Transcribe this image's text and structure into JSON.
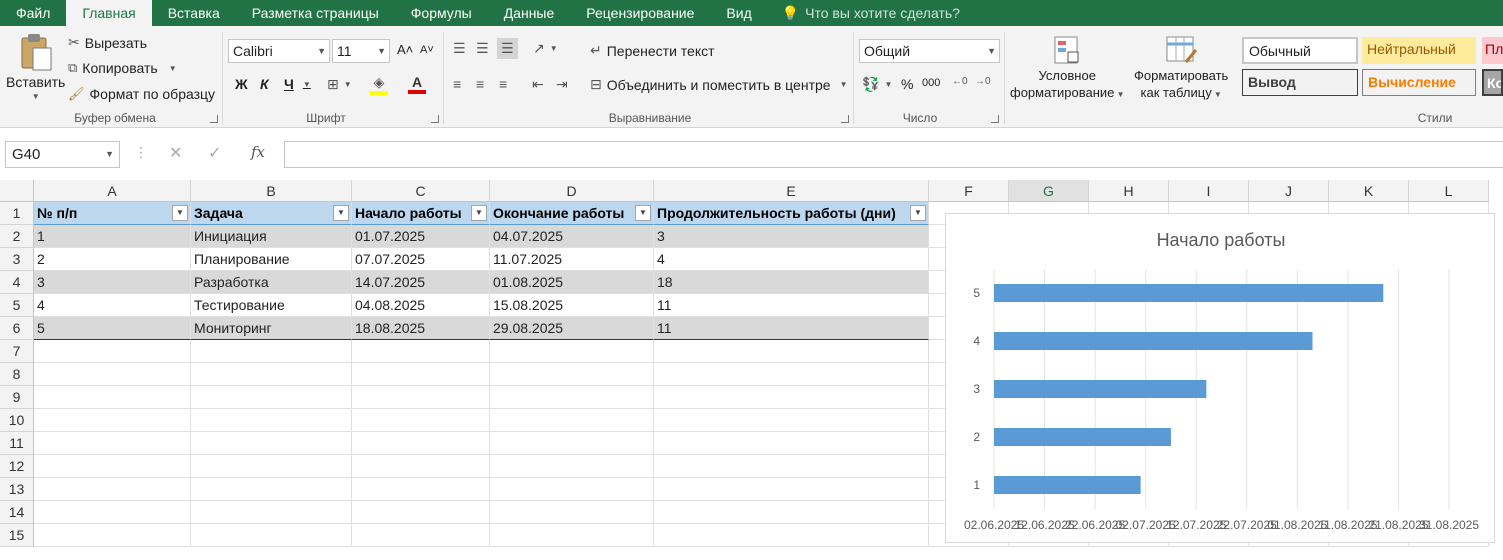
{
  "tabs": [
    "Файл",
    "Главная",
    "Вставка",
    "Разметка страницы",
    "Формулы",
    "Данные",
    "Рецензирование",
    "Вид"
  ],
  "active_tab": "Главная",
  "tell_me": "Что вы хотите сделать?",
  "ribbon": {
    "clipboard": {
      "paste": "Вставить",
      "cut": "Вырезать",
      "copy": "Копировать",
      "format_painter": "Формат по образцу",
      "label": "Буфер обмена"
    },
    "font": {
      "name": "Calibri",
      "size": "11",
      "bold": "Ж",
      "italic": "К",
      "underline": "Ч",
      "label": "Шрифт"
    },
    "alignment": {
      "wrap": "Перенести текст",
      "merge": "Объединить и поместить в центре",
      "label": "Выравнивание"
    },
    "number": {
      "format": "Общий",
      "percent": "%",
      "thousands": "000",
      "label": "Число"
    },
    "styles": {
      "conditional_1": "Условное",
      "conditional_2": "форматирование",
      "as_table_1": "Форматировать",
      "as_table_2": "как таблицу",
      "normal": "Обычный",
      "neutral": "Нейтральный",
      "bad_partial": "Пл",
      "output": "Вывод",
      "calculation": "Вычисление",
      "check_partial": "Ко",
      "label": "Стили"
    }
  },
  "formula_bar": {
    "name_box": "G40",
    "fx": "fx",
    "value": ""
  },
  "columns": [
    "A",
    "B",
    "C",
    "D",
    "E",
    "F",
    "G",
    "H",
    "I",
    "J",
    "K",
    "L"
  ],
  "rows": [
    "1",
    "2",
    "3",
    "4",
    "5",
    "6",
    "7",
    "8",
    "9",
    "10",
    "11",
    "12",
    "13",
    "14",
    "15"
  ],
  "table": {
    "headers": [
      "№ п/п",
      "Задача",
      "Начало работы",
      "Окончание работы",
      "Продолжительность работы (дни)"
    ],
    "data": [
      [
        "1",
        "Инициация",
        "01.07.2025",
        "04.07.2025",
        "3"
      ],
      [
        "2",
        "Планирование",
        "07.07.2025",
        "11.07.2025",
        "4"
      ],
      [
        "3",
        "Разработка",
        "14.07.2025",
        "01.08.2025",
        "18"
      ],
      [
        "4",
        "Тестирование",
        "04.08.2025",
        "15.08.2025",
        "11"
      ],
      [
        "5",
        "Мониторинг",
        "18.08.2025",
        "29.08.2025",
        "11"
      ]
    ]
  },
  "chart_data": {
    "type": "bar",
    "orientation": "horizontal",
    "title": "Начало работы",
    "categories": [
      "1",
      "2",
      "3",
      "4",
      "5"
    ],
    "series": [
      {
        "name": "Начало работы",
        "values": [
          "01.07.2025",
          "07.07.2025",
          "14.07.2025",
          "04.08.2025",
          "18.08.2025"
        ]
      }
    ],
    "x_ticks": [
      "02.06.2025",
      "12.06.2025",
      "22.06.2025",
      "02.07.2025",
      "12.07.2025",
      "22.07.2025",
      "01.08.2025",
      "11.08.2025",
      "21.08.2025",
      "31.08.2025"
    ],
    "xlim": [
      "02.06.2025",
      "31.08.2025"
    ],
    "bar_color": "#5b9bd5",
    "grid": true
  },
  "colors": {
    "excel_green": "#217346",
    "header_fill": "#bdd7ee",
    "band_fill": "#d9d9d9"
  }
}
